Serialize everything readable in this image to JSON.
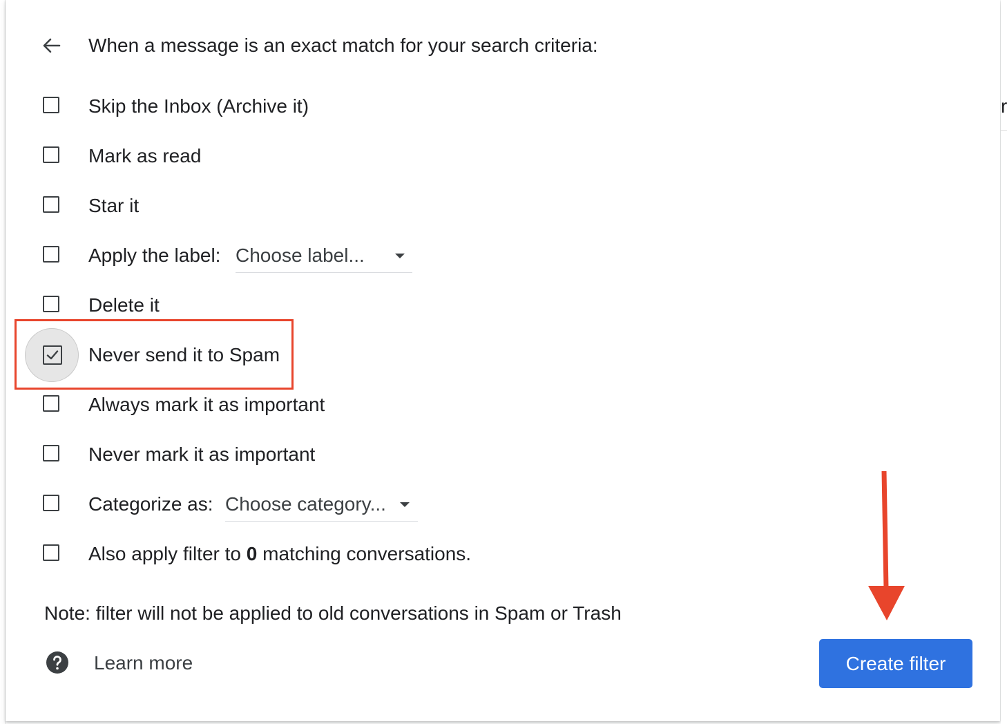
{
  "header": {
    "title": "When a message is an exact match for your search criteria:"
  },
  "options": [
    {
      "label": "Skip the Inbox (Archive it)",
      "checked": false
    },
    {
      "label": "Mark as read",
      "checked": false
    },
    {
      "label": "Star it",
      "checked": false
    },
    {
      "label": "Apply the label:",
      "checked": false,
      "dropdown": "Choose label..."
    },
    {
      "label": "Delete it",
      "checked": false
    },
    {
      "label": "Never send it to Spam",
      "checked": true
    },
    {
      "label": "Always mark it as important",
      "checked": false
    },
    {
      "label": "Never mark it as important",
      "checked": false
    },
    {
      "label": "Categorize as:",
      "checked": false,
      "dropdown": "Choose category..."
    },
    {
      "label_prefix": "Also apply filter to ",
      "label_count": "0",
      "label_suffix": " matching conversations.",
      "checked": false
    }
  ],
  "note": "Note: filter will not be applied to old conversations in Spam or Trash",
  "learn_more": "Learn more",
  "create_button": "Create filter",
  "right_edge_fragment": "r",
  "icons": {
    "back": "arrow-back-icon",
    "help": "help-circle-icon",
    "dropdown": "caret-down-icon",
    "check": "checkmark-icon"
  },
  "colors": {
    "primary_button": "#2f72e0",
    "annotation": "#e8452c",
    "text": "#202124"
  }
}
